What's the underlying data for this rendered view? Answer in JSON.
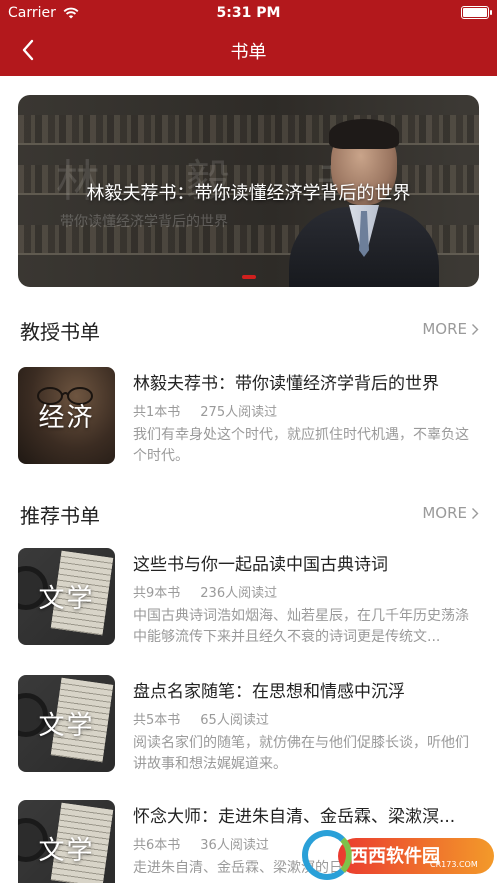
{
  "status_bar": {
    "carrier": "Carrier",
    "time": "5:31 PM"
  },
  "nav": {
    "title": "书单",
    "back_icon": "chevron-left-icon"
  },
  "banner": {
    "caption": "林毅夫荐书：带你读懂经济学背后的世界",
    "background_name": "林 毅 夫",
    "background_subtitle": "带你读懂经济学背后的世界",
    "page_count": 1,
    "active_page": 1
  },
  "sections": [
    {
      "title": "教授书单",
      "more_label": "MORE",
      "items": [
        {
          "thumb_word": "经济",
          "title": "林毅夫荐书：带你读懂经济学背后的世界",
          "count": "共1本书",
          "reads": "275人阅读过",
          "desc": "我们有幸身处这个时代，就应抓住时代机遇，不辜负这个时代。"
        }
      ]
    },
    {
      "title": "推荐书单",
      "more_label": "MORE",
      "items": [
        {
          "thumb_word": "文学",
          "title": "这些书与你一起品读中国古典诗词",
          "count": "共9本书",
          "reads": "236人阅读过",
          "desc": "中国古典诗词浩如烟海、灿若星辰，在几千年历史荡涤中能够流传下来并且经久不衰的诗词更是传统文..."
        },
        {
          "thumb_word": "文学",
          "title": "盘点名家随笔：在思想和情感中沉浮",
          "count": "共5本书",
          "reads": "65人阅读过",
          "desc": "阅读名家们的随笔，就仿佛在与他们促膝长谈，听他们讲故事和想法娓娓道来。"
        },
        {
          "thumb_word": "文学",
          "title": "怀念大师：走进朱自清、金岳霖、梁漱溟...",
          "count": "共6本书",
          "reads": "36人阅读过",
          "desc": "走进朱自清、金岳霖、梁漱溟的日常生活和精神"
        }
      ]
    }
  ],
  "watermark": {
    "text": "西西软件园",
    "sub": "CR173.COM"
  },
  "colors": {
    "brand_red": "#b3181c",
    "muted_text": "#9a9a9a"
  }
}
